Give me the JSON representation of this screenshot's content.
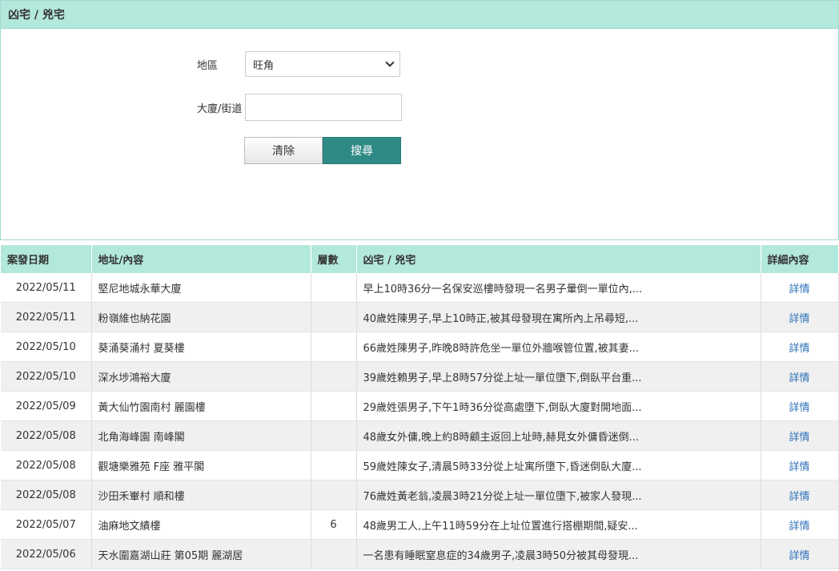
{
  "panel": {
    "title": "凶宅 / 兇宅",
    "district_label": "地區",
    "district_value": "旺角",
    "building_label": "大廈/街道",
    "building_value": "",
    "clear_label": "清除",
    "search_label": "搜尋"
  },
  "table": {
    "headers": [
      "案發日期",
      "地址/內容",
      "層數",
      "凶宅 / 兇宅",
      "詳細內容"
    ],
    "rows": [
      {
        "date": "2022/05/11",
        "address": "堅尼地城永華大廈",
        "floor": "",
        "content": "早上10時36分一名保安巡樓時發現一名男子暈倒一單位內,...",
        "link": "詳情"
      },
      {
        "date": "2022/05/11",
        "address": "粉嶺維也納花園",
        "floor": "",
        "content": "40歲姓陳男子,早上10時正,被其母發現在寓所內上吊尋短,...",
        "link": "詳情"
      },
      {
        "date": "2022/05/10",
        "address": "葵涌葵涌村 夏葵樓",
        "floor": "",
        "content": "66歲姓陳男子,昨晚8時許危坐一單位外牆喉管位置,被其妻...",
        "link": "詳情"
      },
      {
        "date": "2022/05/10",
        "address": "深水埗鴻裕大廈",
        "floor": "",
        "content": "39歲姓賴男子,早上8時57分從上址一單位墮下,倒臥平台重...",
        "link": "詳情"
      },
      {
        "date": "2022/05/09",
        "address": "黃大仙竹園南村 麗園樓",
        "floor": "",
        "content": "29歲姓張男子,下午1時36分從高處墮下,倒臥大廈對開地面...",
        "link": "詳情"
      },
      {
        "date": "2022/05/08",
        "address": "北角海峰園 南峰閣",
        "floor": "",
        "content": "48歲女外傭,晚上約8時顧主返回上址時,赫見女外傭昏迷倒...",
        "link": "詳情"
      },
      {
        "date": "2022/05/08",
        "address": "觀塘樂雅苑 F座 雅平閣",
        "floor": "",
        "content": "59歲姓陳女子,清晨5時33分從上址寓所墮下,昏迷倒臥大廈...",
        "link": "詳情"
      },
      {
        "date": "2022/05/08",
        "address": "沙田禾輋村 順和樓",
        "floor": "",
        "content": "76歲姓黃老翁,凌晨3時21分從上址一單位墮下,被家人發現...",
        "link": "詳情"
      },
      {
        "date": "2022/05/07",
        "address": "油麻地文績樓",
        "floor": "6",
        "content": "48歲男工人,上午11時59分在上址位置進行搭棚期間,疑安...",
        "link": "詳情"
      },
      {
        "date": "2022/05/06",
        "address": "天水圍嘉湖山莊 第05期 麗湖居",
        "floor": "",
        "content": "一名患有睡眠窒息症的34歲男子,凌晨3時50分被其母發現...",
        "link": "詳情"
      }
    ]
  }
}
